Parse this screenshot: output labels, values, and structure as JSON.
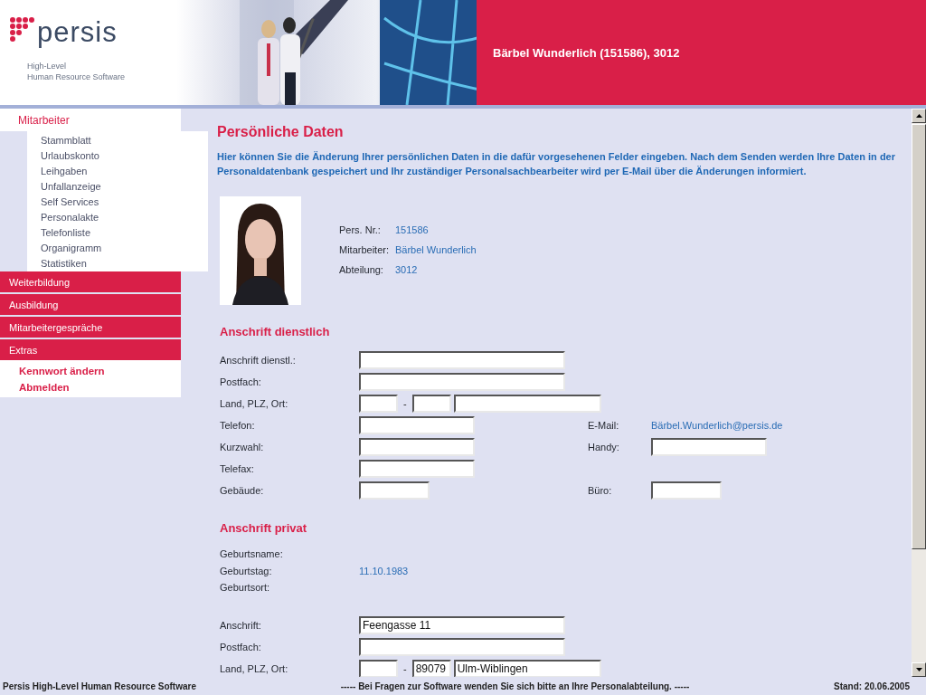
{
  "header": {
    "logo": "persis",
    "tagline": [
      "High-Level",
      "Human Resource Software"
    ],
    "user": "Bärbel Wunderlich (151586), 3012"
  },
  "sidebar": [
    {
      "label": "Mitarbeiter",
      "selected": true,
      "kind": "pages",
      "children": [
        "Stammblatt",
        "Urlaubskonto",
        "Leihgaben",
        "Unfallanzeige",
        "Self Services",
        "Personalakte",
        "Telefonliste",
        "Organigramm",
        "Statistiken"
      ]
    },
    {
      "label": "Weiterbildung",
      "selected": false
    },
    {
      "label": "Ausbildung",
      "selected": false
    },
    {
      "label": "Mitarbeitergespräche",
      "selected": false
    },
    {
      "label": "Extras",
      "selected": false,
      "kind": "actions",
      "children": [
        "Kennwort ändern",
        "Abmelden"
      ]
    }
  ],
  "content": {
    "title": "Persönliche Daten",
    "intro": "Hier können Sie die Änderung Ihrer persönlichen Daten in die dafür vorgesehenen Felder eingeben. Nach dem Senden werden Ihre Daten in der Personaldatenbank gespeichert und Ihr zuständiger Personalsachbearbeiter wird per E-Mail über die Änderungen informiert.",
    "profile": {
      "fields": [
        {
          "label": "Pers. Nr.:",
          "value": "151586"
        },
        {
          "label": "Mitarbeiter:",
          "value": "Bärbel Wunderlich"
        },
        {
          "label": "Abteilung:",
          "value": "3012"
        }
      ]
    },
    "sections": [
      {
        "title": "Anschrift dienstlich",
        "rows": [
          {
            "label": "Anschrift dienstl.:",
            "field": {
              "kind": "wide"
            }
          },
          {
            "label": "Postfach:",
            "field": {
              "kind": "wide"
            }
          },
          {
            "label": "Land, PLZ, Ort:",
            "field": {
              "kind": "place",
              "separator": "-"
            }
          },
          {
            "label": "Telefon:",
            "field": {
              "kind": "medium"
            },
            "side": {
              "label": "E-Mail:",
              "kind": "link",
              "value": "Bärbel.Wunderlich@persis.de"
            }
          },
          {
            "label": "Kurzwahl:",
            "field": {
              "kind": "medium"
            },
            "side": {
              "label": "Handy:",
              "kind": "medium"
            }
          },
          {
            "label": "Telefax:",
            "field": {
              "kind": "medium"
            }
          },
          {
            "label": "Gebäude:",
            "field": {
              "kind": "short"
            },
            "side": {
              "label": "Büro:",
              "kind": "short"
            }
          }
        ]
      },
      {
        "title": "Anschrift privat",
        "rows": [
          {
            "label": "Geburtsname:",
            "field": {
              "kind": "text"
            }
          },
          {
            "label": "Geburtstag:",
            "field": {
              "kind": "text",
              "value": "11.10.1983"
            }
          },
          {
            "label": "Geburtsort:",
            "field": {
              "kind": "text"
            }
          },
          {
            "label": "Anschrift:",
            "field": {
              "kind": "wide",
              "value": "Feengasse 11"
            }
          },
          {
            "label": "Postfach:",
            "field": {
              "kind": "wide"
            }
          },
          {
            "label": "Land, PLZ, Ort:",
            "field": {
              "kind": "place",
              "separator": "-",
              "plz": "89079",
              "city": "Ulm-Wiblingen"
            }
          }
        ]
      }
    ]
  },
  "footer": {
    "left": "Persis High-Level Human Resource Software",
    "center": "----- Bei Fragen zur Software wenden Sie sich bitte an Ihre Personalabteilung. -----",
    "right": "Stand: 20.06.2005"
  }
}
